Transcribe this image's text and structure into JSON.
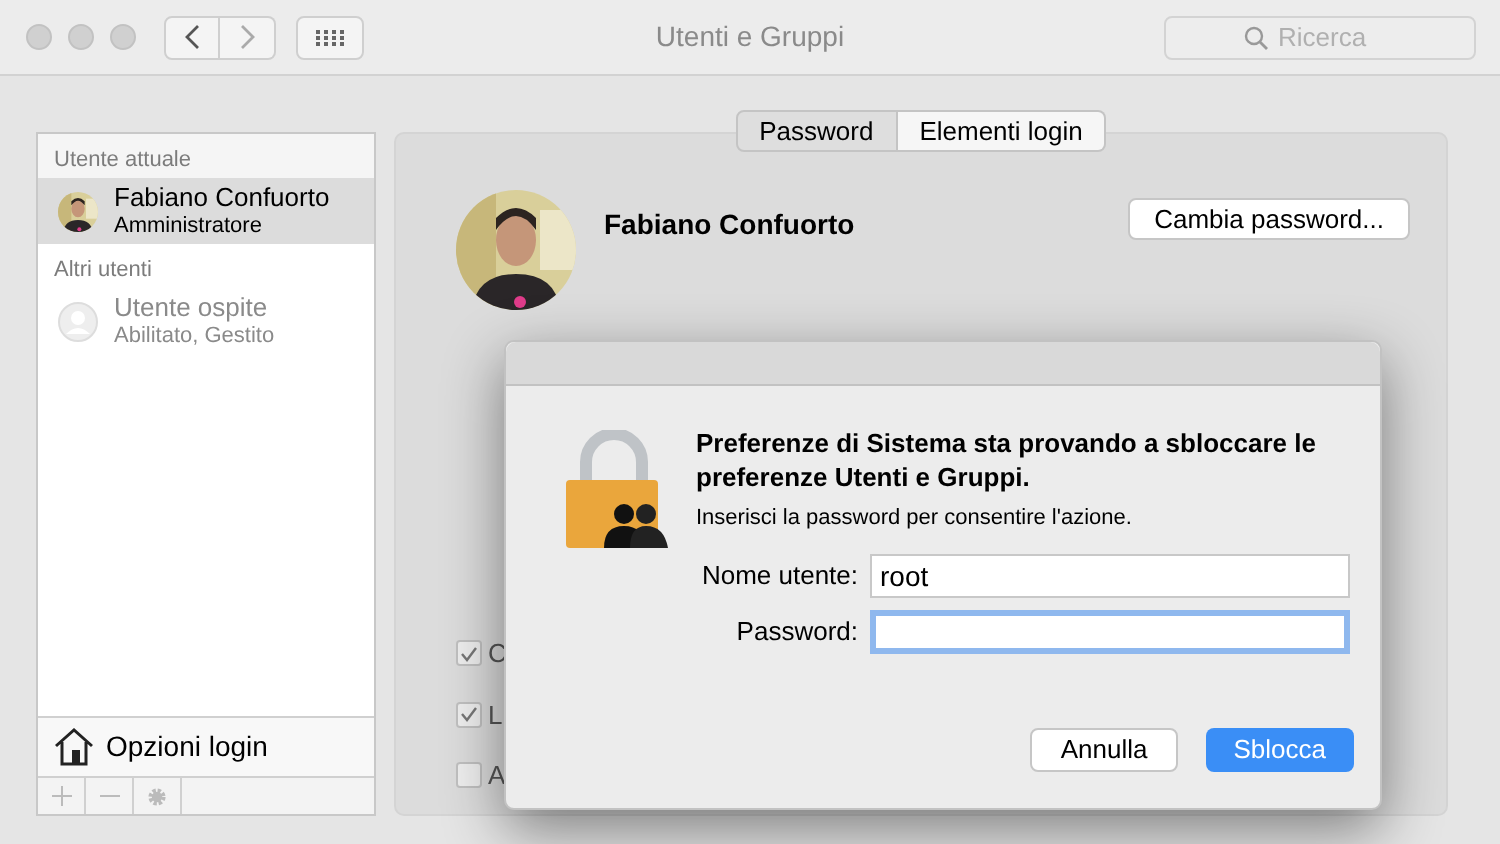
{
  "window": {
    "title": "Utenti e Gruppi",
    "search": {
      "placeholder": "Ricerca"
    }
  },
  "sidebar": {
    "sections": [
      {
        "header": "Utente attuale",
        "users": [
          {
            "name": "Fabiano Confuorto",
            "role": "Amministratore",
            "selected": true
          }
        ]
      },
      {
        "header": "Altri utenti",
        "users": [
          {
            "name": "Utente ospite",
            "role": "Abilitato, Gestito",
            "kind": "guest",
            "selected": false
          }
        ]
      }
    ],
    "login_options": "Opzioni login"
  },
  "tabs": [
    {
      "label": "Password",
      "selected": true
    },
    {
      "label": "Elementi login",
      "selected": false
    }
  ],
  "user": {
    "name": "Fabiano Confuorto",
    "change_password": "Cambia password..."
  },
  "checkboxes": [
    {
      "label": "C",
      "checked": true
    },
    {
      "label": "L",
      "checked": true
    },
    {
      "label": "A",
      "checked": false
    }
  ],
  "dialog": {
    "title": "Preferenze di Sistema sta provando a sbloccare le preferenze Utenti e Gruppi.",
    "message": "Inserisci la password per consentire l'azione.",
    "fields": [
      {
        "label": "Nome utente:",
        "value": "root",
        "focused": false
      },
      {
        "label": "Password:",
        "focused": true
      }
    ],
    "buttons": [
      {
        "label": "Annulla",
        "default": false
      },
      {
        "label": "Sblocca",
        "default": true
      }
    ]
  }
}
